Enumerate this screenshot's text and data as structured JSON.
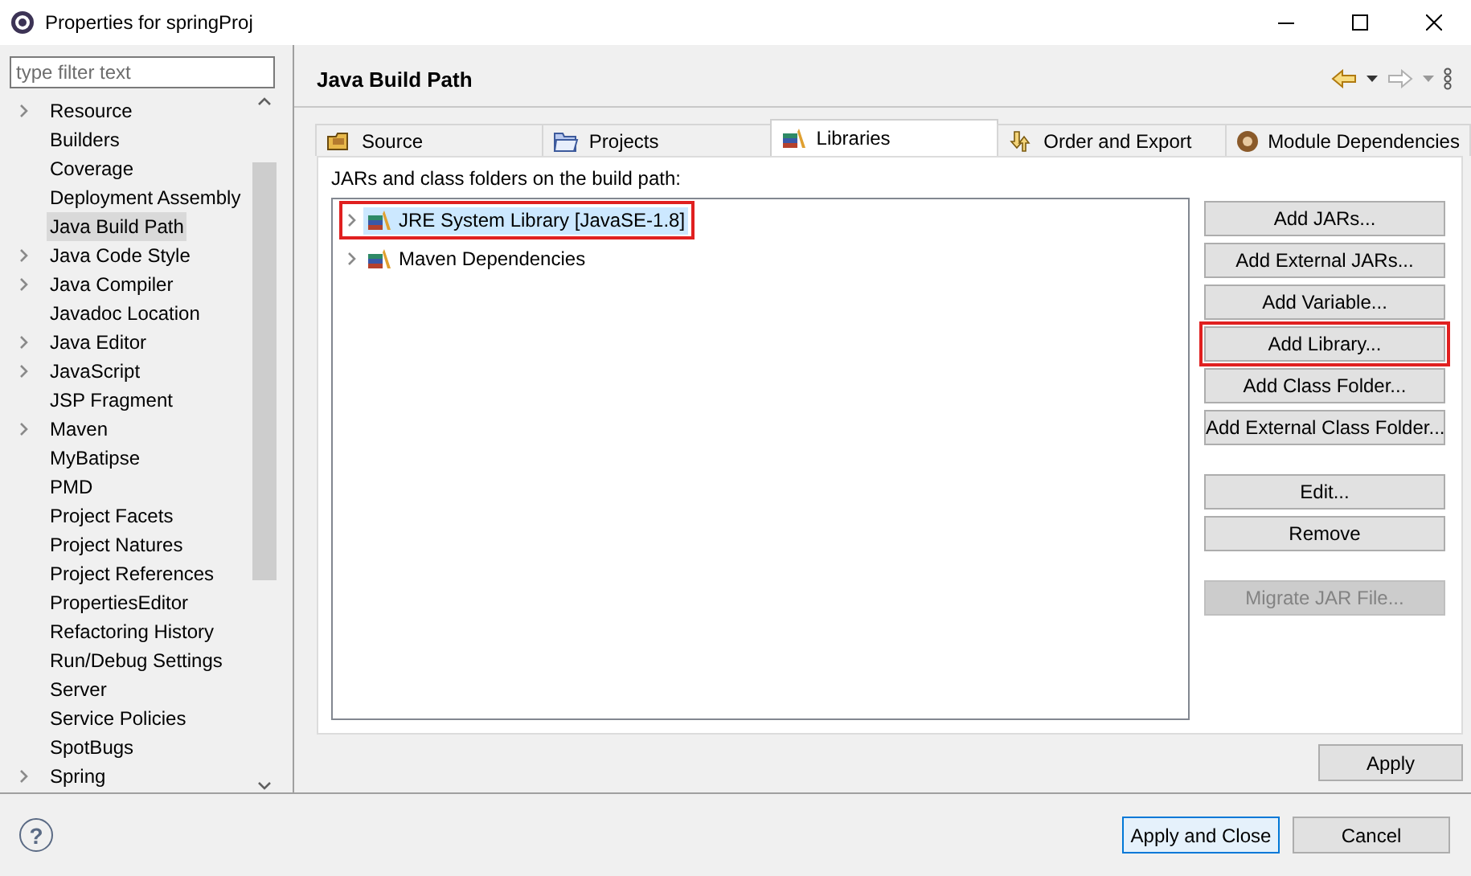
{
  "window": {
    "title": "Properties for springProj"
  },
  "filter": {
    "placeholder": "type filter text"
  },
  "sidebar": {
    "items": [
      {
        "label": "Resource",
        "expandable": true,
        "selected": false
      },
      {
        "label": "Builders",
        "expandable": false,
        "selected": false
      },
      {
        "label": "Coverage",
        "expandable": false,
        "selected": false
      },
      {
        "label": "Deployment Assembly",
        "expandable": false,
        "selected": false
      },
      {
        "label": "Java Build Path",
        "expandable": false,
        "selected": true
      },
      {
        "label": "Java Code Style",
        "expandable": true,
        "selected": false
      },
      {
        "label": "Java Compiler",
        "expandable": true,
        "selected": false
      },
      {
        "label": "Javadoc Location",
        "expandable": false,
        "selected": false
      },
      {
        "label": "Java Editor",
        "expandable": true,
        "selected": false
      },
      {
        "label": "JavaScript",
        "expandable": true,
        "selected": false
      },
      {
        "label": "JSP Fragment",
        "expandable": false,
        "selected": false
      },
      {
        "label": "Maven",
        "expandable": true,
        "selected": false
      },
      {
        "label": "MyBatipse",
        "expandable": false,
        "selected": false
      },
      {
        "label": "PMD",
        "expandable": false,
        "selected": false
      },
      {
        "label": "Project Facets",
        "expandable": false,
        "selected": false
      },
      {
        "label": "Project Natures",
        "expandable": false,
        "selected": false
      },
      {
        "label": "Project References",
        "expandable": false,
        "selected": false
      },
      {
        "label": "PropertiesEditor",
        "expandable": false,
        "selected": false
      },
      {
        "label": "Refactoring History",
        "expandable": false,
        "selected": false
      },
      {
        "label": "Run/Debug Settings",
        "expandable": false,
        "selected": false
      },
      {
        "label": "Server",
        "expandable": false,
        "selected": false
      },
      {
        "label": "Service Policies",
        "expandable": false,
        "selected": false
      },
      {
        "label": "SpotBugs",
        "expandable": false,
        "selected": false
      },
      {
        "label": "Spring",
        "expandable": true,
        "selected": false
      }
    ]
  },
  "page": {
    "title": "Java Build Path",
    "tabs": [
      {
        "label": "Source",
        "selected": false
      },
      {
        "label": "Projects",
        "selected": false
      },
      {
        "label": "Libraries",
        "selected": true
      },
      {
        "label": "Order and Export",
        "selected": false
      },
      {
        "label": "Module Dependencies",
        "selected": false
      }
    ],
    "list_label": "JARs and class folders on the build path:",
    "libraries": [
      {
        "label": "JRE System Library [JavaSE-1.8]",
        "selected": true,
        "highlighted": true
      },
      {
        "label": "Maven Dependencies",
        "selected": false,
        "highlighted": false
      }
    ],
    "button_groups": [
      [
        {
          "label": "Add JARs...",
          "disabled": false,
          "highlighted": false
        },
        {
          "label": "Add External JARs...",
          "disabled": false,
          "highlighted": false
        },
        {
          "label": "Add Variable...",
          "disabled": false,
          "highlighted": false
        },
        {
          "label": "Add Library...",
          "disabled": false,
          "highlighted": true
        },
        {
          "label": "Add Class Folder...",
          "disabled": false,
          "highlighted": false
        },
        {
          "label": "Add External Class Folder...",
          "disabled": false,
          "highlighted": false
        }
      ],
      [
        {
          "label": "Edit...",
          "disabled": false,
          "highlighted": false
        },
        {
          "label": "Remove",
          "disabled": false,
          "highlighted": false
        }
      ],
      [
        {
          "label": "Migrate JAR File...",
          "disabled": true,
          "highlighted": false
        }
      ]
    ],
    "apply": "Apply"
  },
  "footer": {
    "help": "?",
    "buttons": [
      {
        "label": "Apply and Close",
        "default": true
      },
      {
        "label": "Cancel",
        "default": false
      }
    ]
  }
}
